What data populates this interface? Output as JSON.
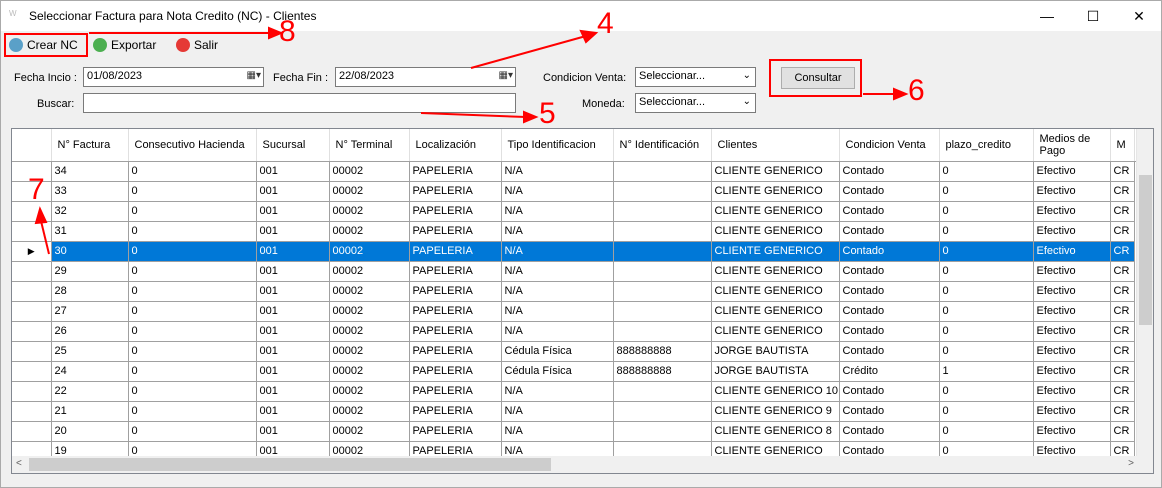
{
  "window": {
    "title": "Seleccionar Factura para Nota Credito (NC) - Clientes",
    "min": "—",
    "max": "☐",
    "close": "✕"
  },
  "toolbar": {
    "crear": "Crear NC",
    "exportar": "Exportar",
    "salir": "Salir"
  },
  "filters": {
    "fecha_inicio_label": "Fecha Incio :",
    "fecha_inicio": "01/08/2023",
    "fecha_fin_label": "Fecha Fin :",
    "fecha_fin": "22/08/2023",
    "buscar_label": "Buscar:",
    "buscar": "",
    "condicion_label": "Condicion Venta:",
    "condicion": "Seleccionar...",
    "moneda_label": "Moneda:",
    "moneda": "Seleccionar...",
    "consultar": "Consultar"
  },
  "grid": {
    "columns": [
      "N° Factura",
      "Consecutivo Hacienda",
      "Sucursal",
      "N° Terminal",
      "Localización",
      "Tipo Identificacion",
      "N° Identificación",
      "Clientes",
      "Condicion Venta",
      "plazo_credito",
      "Medios de Pago",
      "M"
    ],
    "selected_row": 4,
    "rows": [
      [
        "34",
        "0",
        "001",
        "00002",
        "PAPELERIA",
        "N/A",
        "",
        "CLIENTE GENERICO",
        "Contado",
        "0",
        "Efectivo",
        "CR"
      ],
      [
        "33",
        "0",
        "001",
        "00002",
        "PAPELERIA",
        "N/A",
        "",
        "CLIENTE GENERICO",
        "Contado",
        "0",
        "Efectivo",
        "CR"
      ],
      [
        "32",
        "0",
        "001",
        "00002",
        "PAPELERIA",
        "N/A",
        "",
        "CLIENTE GENERICO",
        "Contado",
        "0",
        "Efectivo",
        "CR"
      ],
      [
        "31",
        "0",
        "001",
        "00002",
        "PAPELERIA",
        "N/A",
        "",
        "CLIENTE GENERICO",
        "Contado",
        "0",
        "Efectivo",
        "CR"
      ],
      [
        "30",
        "0",
        "001",
        "00002",
        "PAPELERIA",
        "N/A",
        "",
        "CLIENTE GENERICO",
        "Contado",
        "0",
        "Efectivo",
        "CR"
      ],
      [
        "29",
        "0",
        "001",
        "00002",
        "PAPELERIA",
        "N/A",
        "",
        "CLIENTE GENERICO",
        "Contado",
        "0",
        "Efectivo",
        "CR"
      ],
      [
        "28",
        "0",
        "001",
        "00002",
        "PAPELERIA",
        "N/A",
        "",
        "CLIENTE GENERICO",
        "Contado",
        "0",
        "Efectivo",
        "CR"
      ],
      [
        "27",
        "0",
        "001",
        "00002",
        "PAPELERIA",
        "N/A",
        "",
        "CLIENTE GENERICO",
        "Contado",
        "0",
        "Efectivo",
        "CR"
      ],
      [
        "26",
        "0",
        "001",
        "00002",
        "PAPELERIA",
        "N/A",
        "",
        "CLIENTE GENERICO",
        "Contado",
        "0",
        "Efectivo",
        "CR"
      ],
      [
        "25",
        "0",
        "001",
        "00002",
        "PAPELERIA",
        "Cédula Física",
        "888888888",
        "JORGE BAUTISTA",
        "Contado",
        "0",
        "Efectivo",
        "CR"
      ],
      [
        "24",
        "0",
        "001",
        "00002",
        "PAPELERIA",
        "Cédula Física",
        "888888888",
        "JORGE BAUTISTA",
        "Crédito",
        "1",
        "Efectivo",
        "CR"
      ],
      [
        "22",
        "0",
        "001",
        "00002",
        "PAPELERIA",
        "N/A",
        "",
        "CLIENTE GENERICO 10",
        "Contado",
        "0",
        "Efectivo",
        "CR"
      ],
      [
        "21",
        "0",
        "001",
        "00002",
        "PAPELERIA",
        "N/A",
        "",
        "CLIENTE GENERICO 9",
        "Contado",
        "0",
        "Efectivo",
        "CR"
      ],
      [
        "20",
        "0",
        "001",
        "00002",
        "PAPELERIA",
        "N/A",
        "",
        "CLIENTE GENERICO 8",
        "Contado",
        "0",
        "Efectivo",
        "CR"
      ],
      [
        "19",
        "0",
        "001",
        "00002",
        "PAPELERIA",
        "N/A",
        "",
        "CLIENTE GENERICO",
        "Contado",
        "0",
        "Efectivo",
        "CR"
      ]
    ]
  },
  "annotations": {
    "a4": "4",
    "a5": "5",
    "a6": "6",
    "a7": "7",
    "a8": "8"
  },
  "colors": {
    "selection": "#0078d7",
    "annotation": "#ff0000"
  }
}
